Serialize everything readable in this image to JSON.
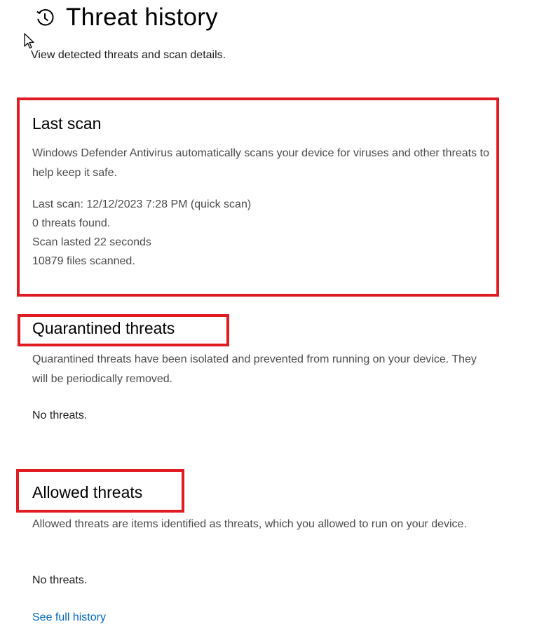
{
  "header": {
    "title": "Threat history",
    "icon": "history-clock-icon",
    "subtitle": "View detected threats and scan details."
  },
  "last_scan": {
    "title": "Last scan",
    "description": "Windows Defender Antivirus automatically scans your device for viruses and other threats to help keep it safe.",
    "details": [
      "Last scan: 12/12/2023 7:28 PM (quick scan)",
      "0 threats found.",
      "Scan lasted 22 seconds",
      "10879 files scanned."
    ]
  },
  "quarantined": {
    "title": "Quarantined threats",
    "description": "Quarantined threats have been isolated and prevented from running on your device.  They will be periodically removed.",
    "status": "No threats."
  },
  "allowed": {
    "title": "Allowed threats",
    "description": "Allowed threats are items identified as threats, which you allowed to run on your device.",
    "status": "No threats."
  },
  "links": {
    "see_full_history": "See full history"
  },
  "colors": {
    "highlight": "#e11b22",
    "link": "#0067c0"
  }
}
